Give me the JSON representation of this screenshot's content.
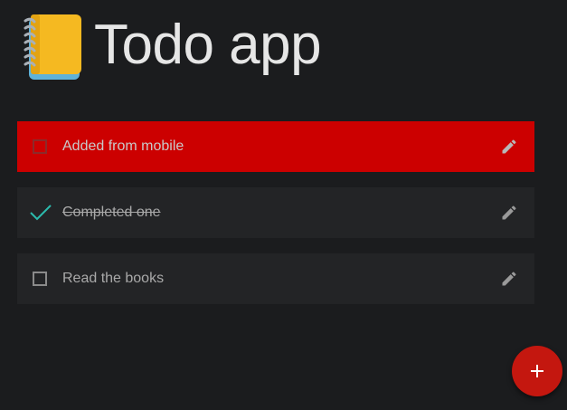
{
  "header": {
    "icon": "notebook-icon",
    "title": "Todo app"
  },
  "todos": [
    {
      "label": "Added from mobile",
      "completed": false,
      "highlighted": true
    },
    {
      "label": "Completed one",
      "completed": true,
      "highlighted": false
    },
    {
      "label": "Read the books",
      "completed": false,
      "highlighted": false
    }
  ],
  "fab": {
    "icon": "plus-icon"
  },
  "colors": {
    "background": "#1b1c1e",
    "item": "#232426",
    "highlight": "#cc0000",
    "check": "#2bbbad",
    "fab": "#c4170f"
  }
}
